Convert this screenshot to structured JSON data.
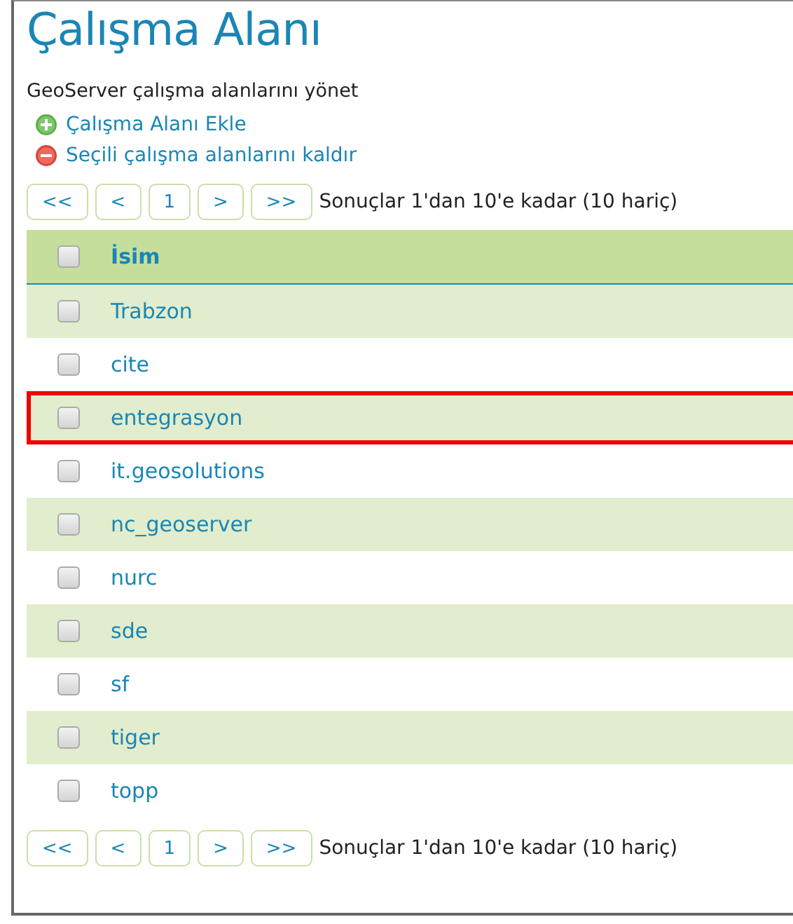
{
  "title": "Çalışma Alanı",
  "description": "GeoServer çalışma alanlarını yönet",
  "actions": [
    {
      "kind": "add",
      "label": "Çalışma Alanı Ekle"
    },
    {
      "kind": "remove",
      "label": "Seçili çalışma alanlarını kaldır"
    }
  ],
  "pager_top": {
    "buttons": [
      "<<",
      "<",
      "1",
      ">",
      ">>"
    ],
    "summary": "Sonuçlar 1'dan 10'e kadar (10 hariç)"
  },
  "table": {
    "columns": [
      "İsim"
    ],
    "header_checked": false,
    "rows": [
      {
        "name": "Trabzon",
        "checked": false,
        "highlighted": false
      },
      {
        "name": "cite",
        "checked": false,
        "highlighted": false
      },
      {
        "name": "entegrasyon",
        "checked": false,
        "highlighted": true
      },
      {
        "name": "it.geosolutions",
        "checked": false,
        "highlighted": false
      },
      {
        "name": "nc_geoserver",
        "checked": false,
        "highlighted": false
      },
      {
        "name": "nurc",
        "checked": false,
        "highlighted": false
      },
      {
        "name": "sde",
        "checked": false,
        "highlighted": false
      },
      {
        "name": "sf",
        "checked": false,
        "highlighted": false
      },
      {
        "name": "tiger",
        "checked": false,
        "highlighted": false
      },
      {
        "name": "topp",
        "checked": false,
        "highlighted": false
      }
    ]
  },
  "pager_bottom": {
    "buttons": [
      "<<",
      "<",
      "1",
      ">",
      ">>"
    ],
    "summary": "Sonuçlar 1'dan 10'e kadar (10 hariç)"
  }
}
